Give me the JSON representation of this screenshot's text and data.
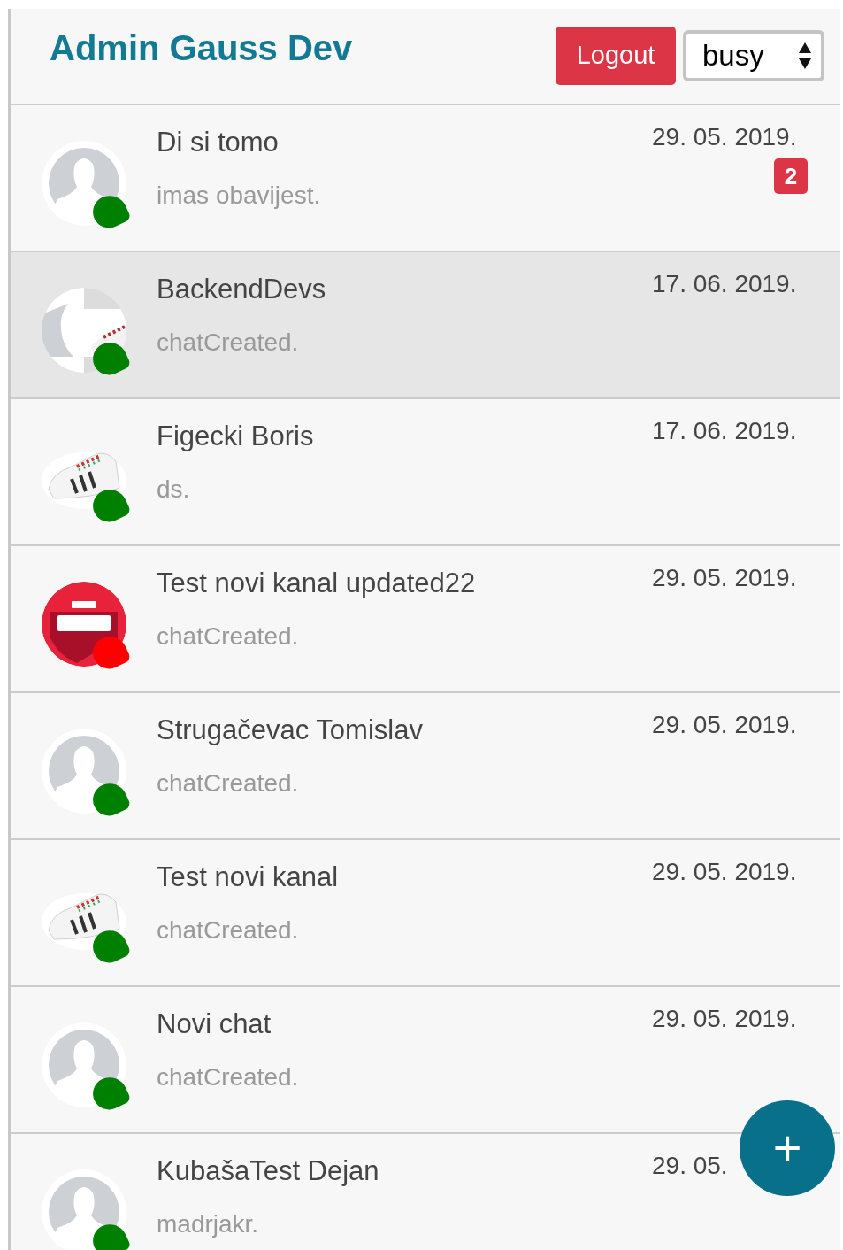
{
  "header": {
    "title": "Admin Gauss Dev",
    "logout_button": "Logout",
    "status_select": "busy"
  },
  "chats": [
    {
      "name": "Di si tomo",
      "message": "imas obavijest.",
      "date": "29. 05. 2019.",
      "unread": "2",
      "color": "#008000",
      "selected": false
    },
    {
      "name": "BackendDevs",
      "message": "chatCreated.",
      "date": "17. 06. 2019.",
      "kind": "picture",
      "color": "#008000",
      "selected": true
    },
    {
      "name": "Figecki Boris",
      "message": "ds.",
      "date": "17. 06. 2019.",
      "kind": "picture",
      "color": "#008000",
      "selected": false
    },
    {
      "name": "Test novi kanal updated22",
      "message": "chatCreated.",
      "date": "29. 05. 2019.",
      "kind": "picture",
      "color": "#ff0000",
      "selected": false
    },
    {
      "name": "Strugačevac Tomislav",
      "message": "chatCreated.",
      "date": "29. 05. 2019.",
      "color": "#008000",
      "selected": false
    },
    {
      "name": "Test novi kanal",
      "message": "chatCreated.",
      "date": "29. 05. 2019.",
      "kind": "picture",
      "color": "#008000",
      "selected": false
    },
    {
      "name": "Novi chat",
      "message": "chatCreated.",
      "date": "29. 05. 2019.",
      "color": "#008000",
      "selected": false
    },
    {
      "name": "KubašaTest Dejan",
      "message": "madrjakr.",
      "date": "29. 05.",
      "color": "#008000",
      "selected": false
    }
  ],
  "new_chat_button": "+"
}
